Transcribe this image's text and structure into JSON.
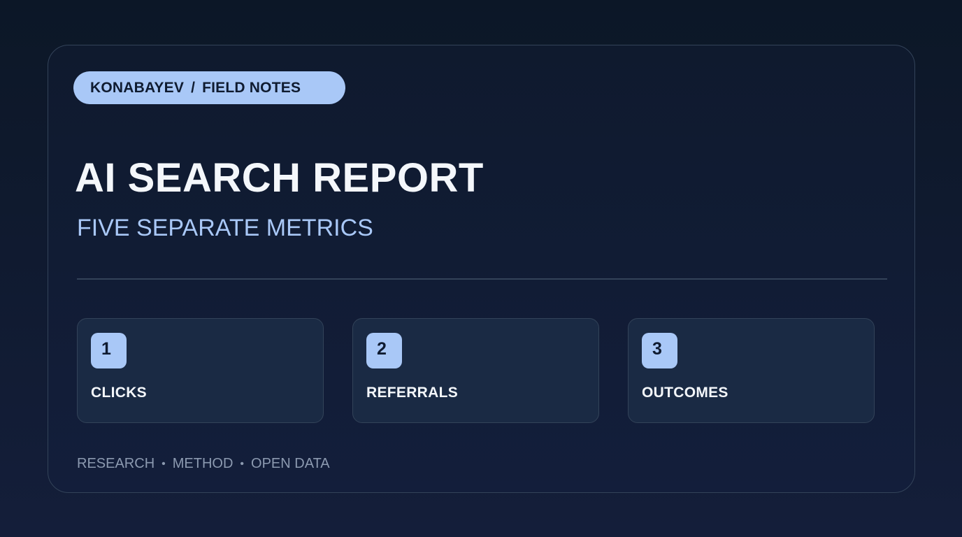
{
  "header": {
    "brand": "KONABAYEV",
    "separator": "/",
    "section": "FIELD NOTES"
  },
  "title": "AI SEARCH REPORT",
  "subtitle": "FIVE SEPARATE METRICS",
  "metrics": [
    {
      "number": "1",
      "label": "CLICKS"
    },
    {
      "number": "2",
      "label": "REFERRALS"
    },
    {
      "number": "3",
      "label": "OUTCOMES"
    }
  ],
  "footer": {
    "items": [
      "RESEARCH",
      "METHOD",
      "OPEN DATA"
    ],
    "separator": "•"
  },
  "colors": {
    "accent": "#a9c8f7",
    "background": "#0f1a2e",
    "card_border": "#334359",
    "tile_background": "#1a2a44",
    "title_text": "#f4f7fb",
    "footer_text": "#8c9ab0"
  }
}
